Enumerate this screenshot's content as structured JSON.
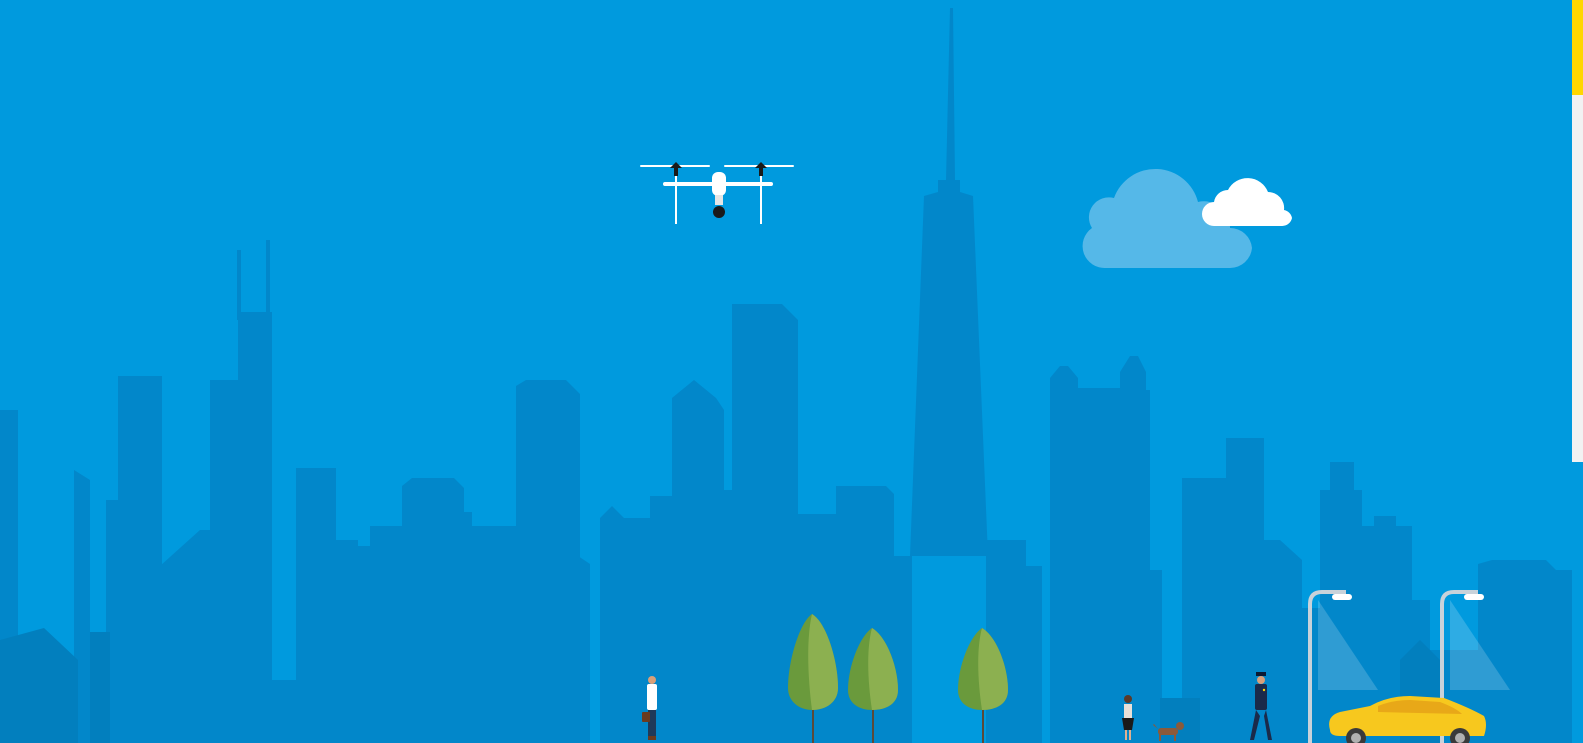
{
  "scene": {
    "sky_color": "#009ade",
    "skyline_color": "#0287ca",
    "skyline_dark_color": "#027fbe",
    "cloud_light_color": "#55b8e8",
    "cloud_white_color": "#ffffff",
    "tree_dark_color": "#6a9a3c",
    "tree_light_color": "#8cb050",
    "trunk_color": "#5a4a3a",
    "car_color": "#f7c81e",
    "lamp_color": "#c8d2da"
  },
  "illustration_elements": [
    "drone-icon",
    "cloud-icon",
    "city-skyline",
    "tree-icon",
    "pedestrian-icon",
    "dog-icon",
    "police-officer-icon",
    "street-lamp-icon",
    "taxi-car-icon"
  ],
  "scrollbar": {
    "thumb_color": "#ffd700",
    "track_color": "#f2f2f2"
  }
}
